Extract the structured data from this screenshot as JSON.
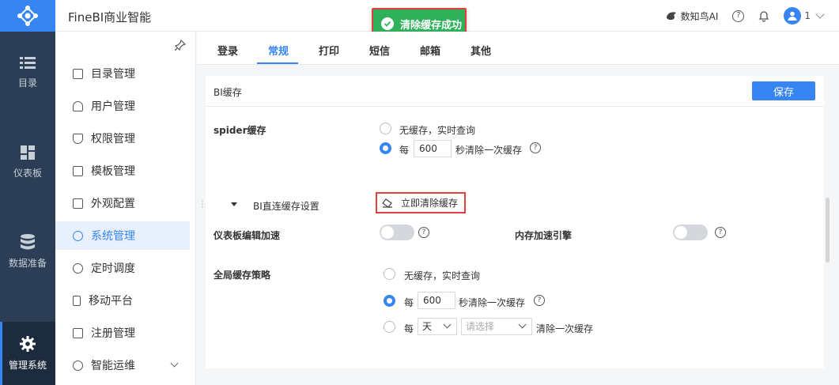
{
  "app": {
    "title": "FineBI商业智能"
  },
  "toast": {
    "message": "清除缓存成功"
  },
  "header": {
    "ai_label": "数知鸟AI",
    "user_name": "1"
  },
  "leftnav": [
    {
      "label": "目录",
      "icon": "list-icon"
    },
    {
      "label": "仪表板",
      "icon": "dashboard-icon"
    },
    {
      "label": "数据准备",
      "icon": "database-icon"
    },
    {
      "label": "管理系统",
      "icon": "gear-icon",
      "active": true
    }
  ],
  "submenu": [
    {
      "label": "目录管理"
    },
    {
      "label": "用户管理"
    },
    {
      "label": "权限管理"
    },
    {
      "label": "模板管理"
    },
    {
      "label": "外观配置"
    },
    {
      "label": "系统管理",
      "active": true
    },
    {
      "label": "定时调度"
    },
    {
      "label": "移动平台"
    },
    {
      "label": "注册管理"
    },
    {
      "label": "智能运维"
    }
  ],
  "tabs": [
    {
      "label": "登录"
    },
    {
      "label": "常规",
      "active": true
    },
    {
      "label": "打印"
    },
    {
      "label": "短信"
    },
    {
      "label": "邮箱"
    },
    {
      "label": "其他"
    }
  ],
  "panel": {
    "title": "BI缓存",
    "save_label": "保存",
    "spider": {
      "label": "spider缓存",
      "opt_none": "无缓存，实时查询",
      "opt_every_prefix": "每",
      "seconds": "600",
      "opt_every_suffix": "秒清除一次缓存"
    },
    "direct": {
      "label": "BI直连缓存设置",
      "clear_label": "立即清除缓存"
    },
    "dashboard_accel": {
      "label": "仪表板编辑加速",
      "enabled": false
    },
    "memory_engine": {
      "label": "内存加速引擎",
      "enabled": false
    },
    "global": {
      "label": "全局缓存策略",
      "opt_none": "无缓存，实时查询",
      "opt_every_prefix": "每",
      "seconds": "600",
      "opt_every_suffix": "秒清除一次缓存",
      "opt_day_prefix": "每",
      "day_unit": "天",
      "select_placeholder": "请选择",
      "opt_day_suffix": "清除一次缓存"
    }
  }
}
